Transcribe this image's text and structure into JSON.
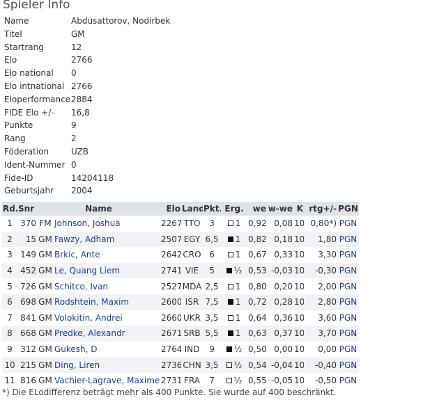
{
  "heading": "Spieler Info",
  "info": [
    {
      "label": "Name",
      "value": "Abdusattorov, Nodirbek"
    },
    {
      "label": "Titel",
      "value": "GM"
    },
    {
      "label": "Startrang",
      "value": "12"
    },
    {
      "label": "Elo",
      "value": "2766"
    },
    {
      "label": "Elo national",
      "value": "0"
    },
    {
      "label": "Elo intnational",
      "value": "2766"
    },
    {
      "label": "Eloperformance",
      "value": "2884"
    },
    {
      "label": "FIDE Elo +/-",
      "value": "16,8"
    },
    {
      "label": "Punkte",
      "value": "9"
    },
    {
      "label": "Rang",
      "value": "2"
    },
    {
      "label": "Föderation",
      "value": "UZB"
    },
    {
      "label": "Ident-Nummer",
      "value": "0"
    },
    {
      "label": "Fide-ID",
      "value": "14204118"
    },
    {
      "label": "Geburtsjahr",
      "value": "2004"
    }
  ],
  "results": {
    "headers": {
      "rd": "Rd.",
      "snr": "Snr",
      "name": "Name",
      "elo": "Elo",
      "land": "Land",
      "pkt": "Pkt.",
      "erg": "Erg.",
      "we": "we",
      "wwe": "w-we",
      "k": "K",
      "rtg": "rtg+/-",
      "pgn": "PGN"
    },
    "rows": [
      {
        "rd": "1",
        "snr": "370",
        "title": "FM",
        "name": "Johnson, Joshua",
        "elo": "2267",
        "land": "TTO",
        "pkt": "3",
        "color": "white",
        "res": "1",
        "we": "0,92",
        "wwe": "0,08",
        "k": "10",
        "rtg": "0,80*)",
        "pgn": "PGN"
      },
      {
        "rd": "2",
        "snr": "15",
        "title": "GM",
        "name": "Fawzy, Adham",
        "elo": "2507",
        "land": "EGY",
        "pkt": "6,5",
        "color": "black",
        "res": "1",
        "we": "0,82",
        "wwe": "0,18",
        "k": "10",
        "rtg": "1,80",
        "pgn": "PGN"
      },
      {
        "rd": "3",
        "snr": "149",
        "title": "GM",
        "name": "Brkic, Ante",
        "elo": "2642",
        "land": "CRO",
        "pkt": "6",
        "color": "white",
        "res": "1",
        "we": "0,67",
        "wwe": "0,33",
        "k": "10",
        "rtg": "3,30",
        "pgn": "PGN"
      },
      {
        "rd": "4",
        "snr": "452",
        "title": "GM",
        "name": "Le, Quang Liem",
        "elo": "2741",
        "land": "VIE",
        "pkt": "5",
        "color": "black",
        "res": "½",
        "we": "0,53",
        "wwe": "-0,03",
        "k": "10",
        "rtg": "-0,30",
        "pgn": "PGN"
      },
      {
        "rd": "5",
        "snr": "726",
        "title": "GM",
        "name": "Schitco, Ivan",
        "elo": "2527",
        "land": "MDA",
        "pkt": "2,5",
        "color": "white",
        "res": "1",
        "we": "0,80",
        "wwe": "0,20",
        "k": "10",
        "rtg": "2,00",
        "pgn": "PGN"
      },
      {
        "rd": "6",
        "snr": "698",
        "title": "GM",
        "name": "Rodshtein, Maxim",
        "elo": "2600",
        "land": "ISR",
        "pkt": "7,5",
        "color": "black",
        "res": "1",
        "we": "0,72",
        "wwe": "0,28",
        "k": "10",
        "rtg": "2,80",
        "pgn": "PGN"
      },
      {
        "rd": "7",
        "snr": "841",
        "title": "GM",
        "name": "Volokitin, Andrei",
        "elo": "2660",
        "land": "UKR",
        "pkt": "3,5",
        "color": "white",
        "res": "1",
        "we": "0,64",
        "wwe": "0,36",
        "k": "10",
        "rtg": "3,60",
        "pgn": "PGN"
      },
      {
        "rd": "8",
        "snr": "668",
        "title": "GM",
        "name": "Predke, Alexandr",
        "elo": "2671",
        "land": "SRB",
        "pkt": "5,5",
        "color": "black",
        "res": "1",
        "we": "0,63",
        "wwe": "0,37",
        "k": "10",
        "rtg": "3,70",
        "pgn": "PGN"
      },
      {
        "rd": "9",
        "snr": "312",
        "title": "GM",
        "name": "Gukesh, D",
        "elo": "2764",
        "land": "IND",
        "pkt": "9",
        "color": "black",
        "res": "½",
        "we": "0,50",
        "wwe": "0,00",
        "k": "10",
        "rtg": "0,00",
        "pgn": "PGN"
      },
      {
        "rd": "10",
        "snr": "215",
        "title": "GM",
        "name": "Ding, Liren",
        "elo": "2736",
        "land": "CHN",
        "pkt": "3,5",
        "color": "white",
        "res": "½",
        "we": "0,54",
        "wwe": "-0,04",
        "k": "10",
        "rtg": "-0,40",
        "pgn": "PGN"
      },
      {
        "rd": "11",
        "snr": "816",
        "title": "GM",
        "name": "Vachier-Lagrave, Maxime",
        "elo": "2731",
        "land": "FRA",
        "pkt": "7",
        "color": "white",
        "res": "½",
        "we": "0,55",
        "wwe": "-0,05",
        "k": "10",
        "rtg": "-0,50",
        "pgn": "PGN"
      }
    ]
  },
  "footnote": "*) Die ELodifferenz beträgt mehr als 400 Punkte. Sie wurde auf 400 beschränkt.",
  "colors": {
    "link": "#1c3f94",
    "header_bg": "#dfe3e8",
    "alt_row_bg": "#f1f3f6"
  }
}
